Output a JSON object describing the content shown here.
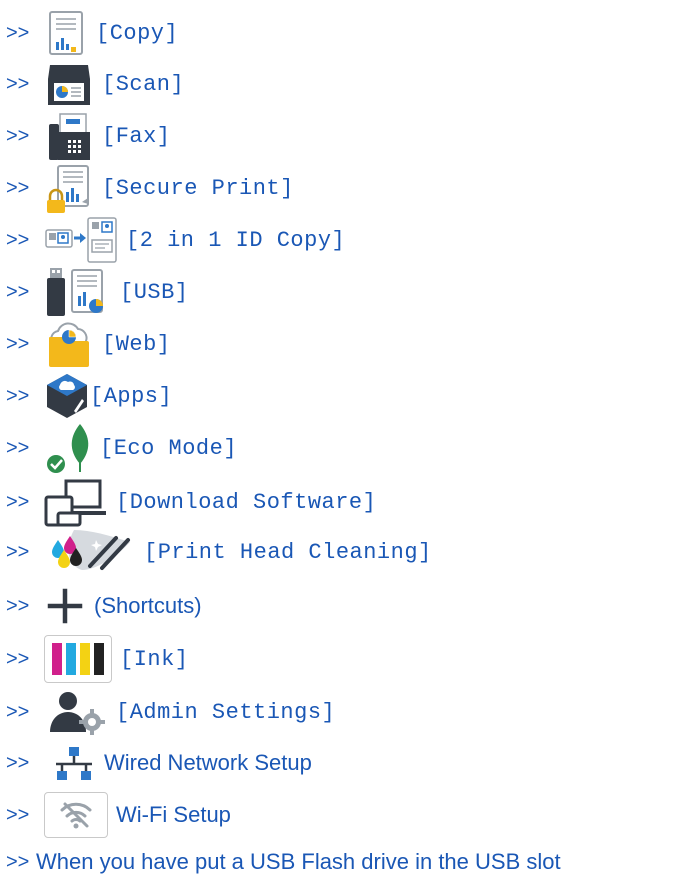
{
  "arrow": ">>",
  "items": [
    {
      "label": "[Copy]",
      "icon": "copy-icon"
    },
    {
      "label": "[Scan]",
      "icon": "scan-icon"
    },
    {
      "label": "[Fax]",
      "icon": "fax-icon"
    },
    {
      "label": "[Secure Print]",
      "icon": "secure-print-icon"
    },
    {
      "label": "[2 in 1 ID Copy]",
      "icon": "id-copy-icon"
    },
    {
      "label": "[USB]",
      "icon": "usb-icon"
    },
    {
      "label": "[Web]",
      "icon": "web-icon"
    },
    {
      "label": "[Apps]",
      "icon": "apps-icon"
    },
    {
      "label": "[Eco Mode]",
      "icon": "eco-mode-icon"
    },
    {
      "label": "[Download Software]",
      "icon": "download-software-icon"
    },
    {
      "label": "[Print Head Cleaning]",
      "icon": "print-head-cleaning-icon"
    },
    {
      "label": "(Shortcuts)",
      "icon": "plus-icon"
    },
    {
      "label": "[Ink]",
      "icon": "ink-icon"
    },
    {
      "label": "[Admin Settings]",
      "icon": "admin-settings-icon"
    },
    {
      "label": "Wired Network Setup",
      "icon": "wired-network-icon"
    },
    {
      "label": "Wi-Fi Setup",
      "icon": "wifi-icon"
    },
    {
      "label": "When you have put a USB Flash drive in the USB slot"
    }
  ],
  "colors": {
    "link": "#1a57b5",
    "icon_blue": "#2e78c8",
    "icon_dark": "#333a44",
    "icon_yellow": "#f3b81b",
    "icon_green": "#2f8f4e",
    "icon_gray": "#9aa2aa"
  }
}
